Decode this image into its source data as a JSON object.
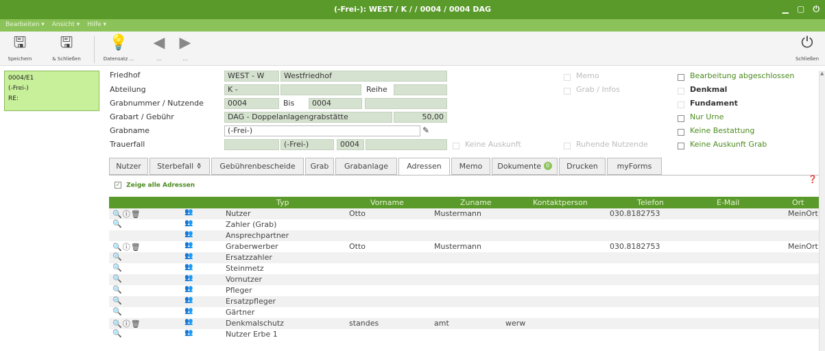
{
  "window": {
    "title": "(-Frei-): WEST / K / / 0004 / 0004 DAG",
    "controls": "▁ ▢ ⏻"
  },
  "menu": [
    "Bearbeiten ▾",
    "Ansicht ▾",
    "Hilfe ▾"
  ],
  "toolbar": {
    "save": {
      "label": "Speichern",
      "icon": "save-icon"
    },
    "save_close": {
      "label": "& Schließen",
      "icon": "save-close-icon"
    },
    "record": {
      "label": "Datensatz ...",
      "icon": "lightbulb-icon"
    },
    "back": {
      "label": "...",
      "icon": "back-icon"
    },
    "forward": {
      "label": "...",
      "icon": "forward-icon"
    },
    "close": {
      "label": "Schließen",
      "icon": "power-icon"
    }
  },
  "record_box": {
    "line1": "0004/E1",
    "line2": "(-Frei-)",
    "line3": "RE:"
  },
  "form": {
    "friedhof_label": "Friedhof",
    "friedhof_code": "WEST - W",
    "friedhof_name": "Westfriedhof",
    "abteilung_label": "Abteilung",
    "abteilung_value": "K -",
    "reihe_label": "Reihe",
    "grabnummer_label": "Grabnummer / Nutzende",
    "grabnummer_value": "0004",
    "bis_label": "Bis",
    "bis_value": "0004",
    "grabart_label": "Grabart / Gebühr",
    "grabart_value": "DAG - Doppelanlagengrabstätte",
    "gebuehr_value": "50,00",
    "grabname_label": "Grabname",
    "grabname_value": "(-Frei-)",
    "trauerfall_label": "Trauerfall",
    "trauerfall_value": "(-Frei-)",
    "trauerfall_num": "0004"
  },
  "options_mid": {
    "memo": "Memo",
    "grab_infos": "Grab / Infos",
    "keine_auskunft": "Keine Auskunft",
    "ruhende_nutzende": "Ruhende Nutzende"
  },
  "options_right": {
    "bearbeitung": "Bearbeitung abgeschlossen",
    "denkmal": "Denkmal",
    "fundament": "Fundament",
    "nur_urne": "Nur Urne",
    "keine_bestattung": "Keine Bestattung",
    "keine_auskunft_grab": "Keine Auskunft Grab"
  },
  "tabs": [
    "Nutzer",
    "Sterbefall ⚱",
    "Gebührenbescheide",
    "Grab",
    "Grabanlage",
    "Adressen",
    "Memo",
    "Dokumente",
    "Drucken",
    "myForms"
  ],
  "active_tab": "Adressen",
  "dokumente_badge": "0",
  "show_all_label": "Zeige alle Adressen",
  "table": {
    "headers": [
      "Typ",
      "Vorname",
      "Zuname",
      "Kontaktperson",
      "Telefon",
      "E-Mail",
      "Ort"
    ],
    "rows": [
      {
        "actions": "🔍ⓘ🗑",
        "typ": "Nutzer",
        "vorname": "Otto",
        "zuname": "Mustermann",
        "kontakt": "",
        "telefon": "030.8182753",
        "email": "",
        "ort": "MeinOrt"
      },
      {
        "actions": "🔍",
        "typ": "Zahler (Grab)",
        "vorname": "",
        "zuname": "",
        "kontakt": "",
        "telefon": "",
        "email": "",
        "ort": ""
      },
      {
        "actions": "",
        "typ": "Ansprechpartner",
        "vorname": "",
        "zuname": "",
        "kontakt": "",
        "telefon": "",
        "email": "",
        "ort": ""
      },
      {
        "actions": "🔍ⓘ🗑",
        "typ": "Graberwerber",
        "vorname": "Otto",
        "zuname": "Mustermann",
        "kontakt": "",
        "telefon": "030.8182753",
        "email": "",
        "ort": "MeinOrt"
      },
      {
        "actions": "🔍",
        "typ": "Ersatzzahler",
        "vorname": "",
        "zuname": "",
        "kontakt": "",
        "telefon": "",
        "email": "",
        "ort": ""
      },
      {
        "actions": "🔍",
        "typ": "Steinmetz",
        "vorname": "",
        "zuname": "",
        "kontakt": "",
        "telefon": "",
        "email": "",
        "ort": ""
      },
      {
        "actions": "🔍",
        "typ": "Vornutzer",
        "vorname": "",
        "zuname": "",
        "kontakt": "",
        "telefon": "",
        "email": "",
        "ort": ""
      },
      {
        "actions": "🔍",
        "typ": "Pfleger",
        "vorname": "",
        "zuname": "",
        "kontakt": "",
        "telefon": "",
        "email": "",
        "ort": ""
      },
      {
        "actions": "🔍",
        "typ": "Ersatzpfleger",
        "vorname": "",
        "zuname": "",
        "kontakt": "",
        "telefon": "",
        "email": "",
        "ort": ""
      },
      {
        "actions": "🔍",
        "typ": "Gärtner",
        "vorname": "",
        "zuname": "",
        "kontakt": "",
        "telefon": "",
        "email": "",
        "ort": ""
      },
      {
        "actions": "🔍ⓘ🗑",
        "typ": "Denkmalschutz",
        "vorname": "standes",
        "zuname": "amt",
        "kontakt": "werw",
        "telefon": "",
        "email": "",
        "ort": ""
      },
      {
        "actions": "🔍",
        "typ": "Nutzer Erbe 1",
        "vorname": "",
        "zuname": "",
        "kontakt": "",
        "telefon": "",
        "email": "",
        "ort": ""
      }
    ]
  },
  "colors": {
    "titlebar": "#5a9a2a",
    "menubar": "#8cc25a",
    "field": "#d6e2d0",
    "record_box": "#c8f09a"
  }
}
